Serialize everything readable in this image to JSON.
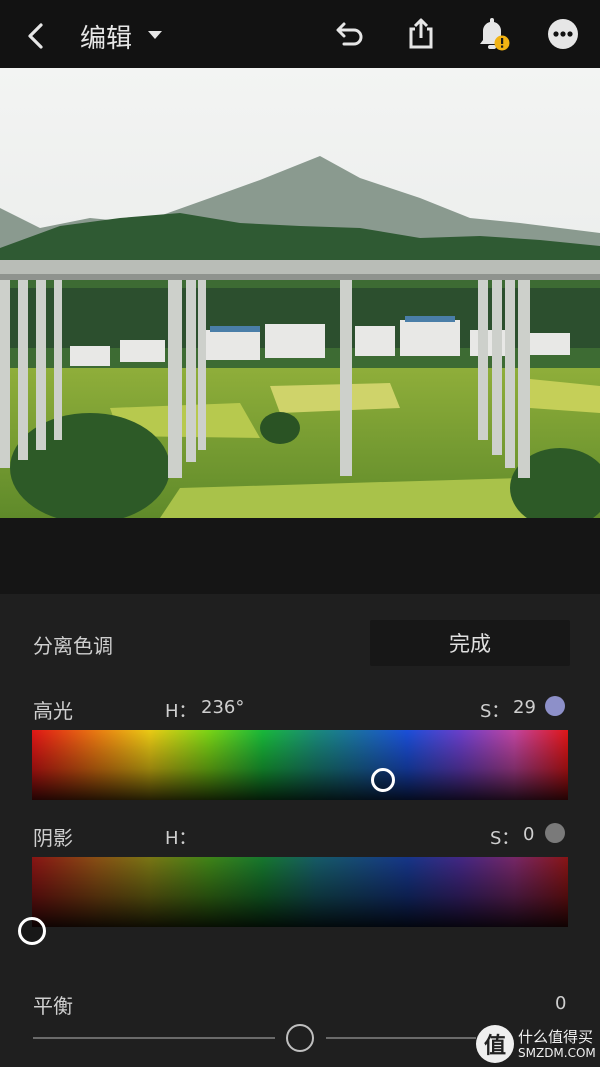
{
  "header": {
    "title": "编辑"
  },
  "panel": {
    "title": "分离色调",
    "done_label": "完成",
    "highlights": {
      "label": "高光",
      "h_label": "H：",
      "h_value": "236°",
      "s_label": "S：",
      "s_value": "29",
      "swatch_color": "#8d90c9"
    },
    "shadows": {
      "label": "阴影",
      "h_label": "H：",
      "h_value": "",
      "s_label": "S：",
      "s_value": "0",
      "swatch_color": "#7a7a7a"
    },
    "balance": {
      "label": "平衡",
      "value": "0"
    }
  },
  "watermark": {
    "badge": "值",
    "line1": "什么值得买",
    "line2": "SMZDM.COM"
  },
  "icons": [
    "chevron-left-icon",
    "caret-down-icon",
    "undo-icon",
    "share-icon",
    "bell-alert-icon",
    "more-icon"
  ],
  "colors": {
    "accent_alert": "#f2b313",
    "topbar_bg": "#121212",
    "panel_bg": "#1f1f1f"
  }
}
